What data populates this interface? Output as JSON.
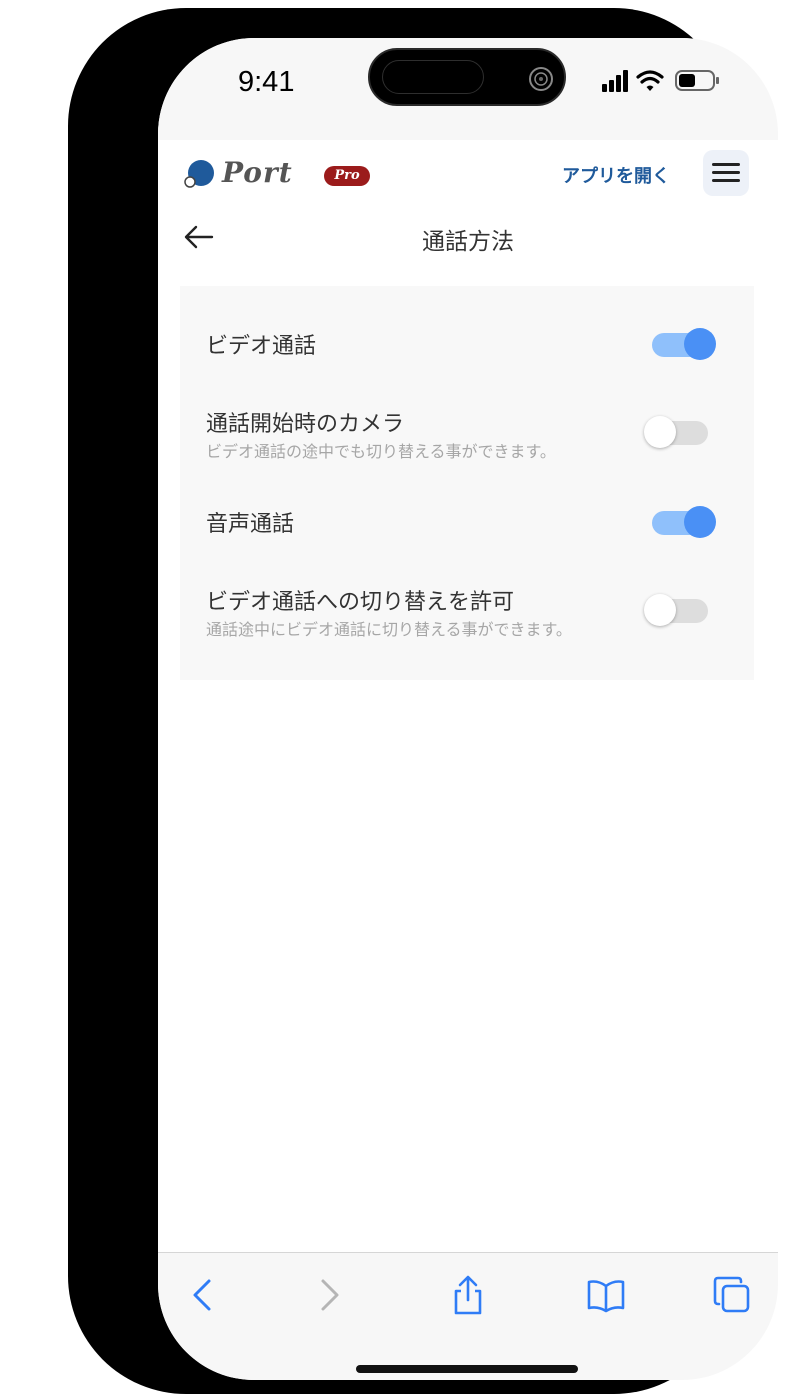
{
  "status_bar": {
    "time": "9:41"
  },
  "header": {
    "logo_text": "Port",
    "logo_badge": "Pro",
    "open_app_label": "アプリを開く",
    "menu_icon": "hamburger-menu-icon"
  },
  "page": {
    "title": "通話方法",
    "back_icon": "arrow-left-icon"
  },
  "settings": [
    {
      "label": "ビデオ通話",
      "description": "",
      "enabled": true
    },
    {
      "label": "通話開始時のカメラ",
      "description": "ビデオ通話の途中でも切り替える事ができます。",
      "enabled": false
    },
    {
      "label": "音声通話",
      "description": "",
      "enabled": true
    },
    {
      "label": "ビデオ通話への切り替えを許可",
      "description": "通話途中にビデオ通話に切り替える事ができます。",
      "enabled": false
    }
  ],
  "toolbar": {
    "icons": [
      "back-chevron-icon",
      "forward-chevron-icon",
      "share-icon",
      "bookmarks-icon",
      "tabs-icon"
    ]
  },
  "colors": {
    "accent": "#4a90f5",
    "toggle_on_track": "#8fc0fb",
    "toggle_off_track": "#dddddd",
    "link": "#1f5a9b",
    "logo_badge": "#9b1b1b",
    "toolbar_icon": "#2f7cf6"
  }
}
